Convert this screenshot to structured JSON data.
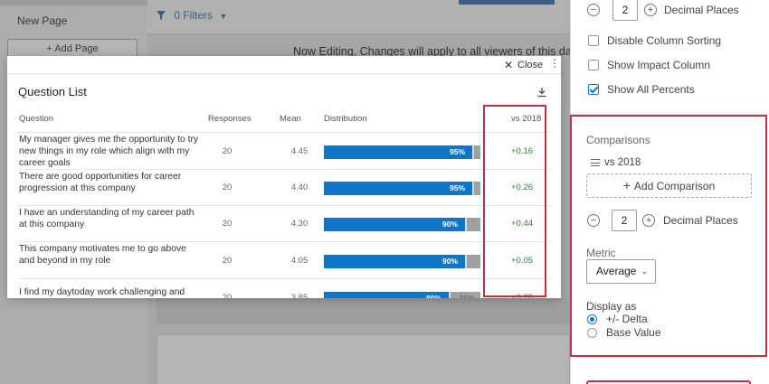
{
  "left_nav": {
    "page_label": "New Page",
    "add_page_label": "+ Add Page"
  },
  "filters": {
    "label": "0 Filters"
  },
  "banner": {
    "text": "Now Editing. Changes will apply to all viewers of this da"
  },
  "modal": {
    "close_label": "Close",
    "title": "Question List",
    "columns": {
      "question": "Question",
      "responses": "Responses",
      "mean": "Mean",
      "distribution": "Distribution",
      "comparison": "vs 2018"
    },
    "rows": [
      {
        "question": "My manager gives me the opportunity to try new things in my role which align with my career goals",
        "responses": "20",
        "mean": "4.45",
        "pct": "95%",
        "fill": 0.95,
        "rest_pct": "",
        "delta": "+0.16"
      },
      {
        "question": "There are good opportunities for career progression at this company",
        "responses": "20",
        "mean": "4.40",
        "pct": "95%",
        "fill": 0.95,
        "rest_pct": "",
        "delta": "+0.26"
      },
      {
        "question": "I have an understanding of my career path at this company",
        "responses": "20",
        "mean": "4.30",
        "pct": "90%",
        "fill": 0.9,
        "rest_pct": "",
        "delta": "+0.44"
      },
      {
        "question": "This company motivates me to go above and beyond in my role",
        "responses": "20",
        "mean": "4.05",
        "pct": "90%",
        "fill": 0.9,
        "rest_pct": "",
        "delta": "+0.05"
      },
      {
        "question": "I find my daytoday work challenging and",
        "responses": "20",
        "mean": "3.85",
        "pct": "80%",
        "fill": 0.8,
        "rest_pct": "15%",
        "delta": "+0.28"
      }
    ]
  },
  "panel": {
    "top_decimal_value": "2",
    "decimal_places_label": "Decimal Places",
    "options": [
      {
        "label": "Disable Column Sorting",
        "checked": false
      },
      {
        "label": "Show Impact Column",
        "checked": false
      },
      {
        "label": "Show All Percents",
        "checked": true
      }
    ],
    "comparisons": {
      "title": "Comparisons",
      "item": "vs 2018",
      "add_label": "Add Comparison",
      "decimal_value": "2",
      "decimal_places_label": "Decimal Places",
      "metric_label": "Metric",
      "metric_value": "Average",
      "display_as_label": "Display as",
      "display_options": [
        {
          "label": "+/- Delta",
          "selected": true
        },
        {
          "label": "Base Value",
          "selected": false
        }
      ]
    }
  },
  "colors": {
    "accent": "#0f76c6",
    "highlight": "#c0313c",
    "positive": "#2e7d32"
  }
}
